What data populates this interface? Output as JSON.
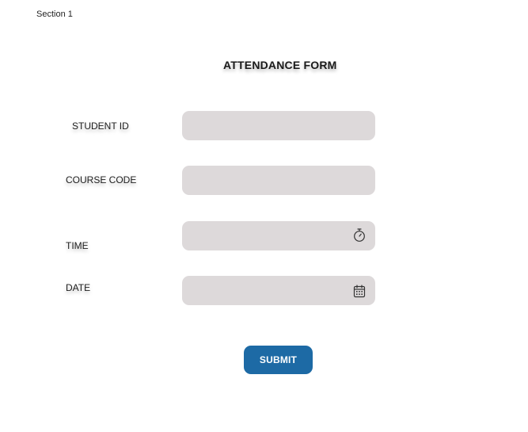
{
  "section": {
    "label": "Section 1"
  },
  "form": {
    "title": "ATTENDANCE FORM",
    "fields": {
      "student_id": {
        "label": "STUDENT ID",
        "value": ""
      },
      "course_code": {
        "label": "COURSE CODE",
        "value": ""
      },
      "time": {
        "label": "TIME",
        "value": "",
        "icon": "stopwatch-icon"
      },
      "date": {
        "label": "DATE",
        "value": "",
        "icon": "calendar-icon"
      }
    },
    "submit_label": "SUBMIT"
  },
  "colors": {
    "field_background": "#ddd9da",
    "submit_background": "#1d6aa5",
    "submit_text": "#ffffff"
  }
}
